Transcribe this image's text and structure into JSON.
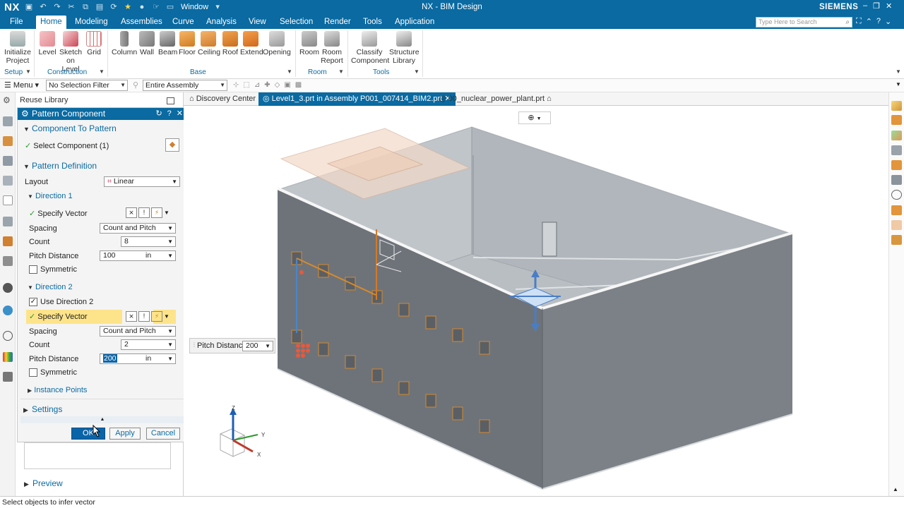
{
  "app": {
    "logo": "NX",
    "title": "NX - BIM Design",
    "brand": "SIEMENS",
    "window_menu": "Window"
  },
  "menubar": {
    "tabs": [
      "File",
      "Home",
      "Modeling",
      "Assemblies",
      "Curve",
      "Analysis",
      "View",
      "Selection",
      "Render",
      "Tools",
      "Application"
    ],
    "active": "Home",
    "search_placeholder": "Type Here to Search"
  },
  "ribbon": {
    "buttons": [
      {
        "label": "Initialize\nProject",
        "icon": "initialize-project-icon"
      },
      {
        "label": "Level",
        "icon": "level-icon"
      },
      {
        "label": "Sketch\non Level",
        "icon": "sketch-on-level-icon"
      },
      {
        "label": "Grid",
        "icon": "grid-icon"
      },
      {
        "label": "Column",
        "icon": "column-icon"
      },
      {
        "label": "Wall",
        "icon": "wall-icon"
      },
      {
        "label": "Beam",
        "icon": "beam-icon"
      },
      {
        "label": "Floor",
        "icon": "floor-icon"
      },
      {
        "label": "Ceiling",
        "icon": "ceiling-icon"
      },
      {
        "label": "Roof",
        "icon": "roof-icon"
      },
      {
        "label": "Extend",
        "icon": "extend-icon"
      },
      {
        "label": "Opening",
        "icon": "opening-icon"
      },
      {
        "label": "Room",
        "icon": "room-icon"
      },
      {
        "label": "Room\nReport",
        "icon": "room-report-icon"
      },
      {
        "label": "Classify\nComponent",
        "icon": "classify-component-icon"
      },
      {
        "label": "Structure\nLibrary",
        "icon": "structure-library-icon"
      }
    ],
    "groups": [
      "Setup",
      "Construction",
      "Base",
      "Room",
      "Tools"
    ]
  },
  "selection_bar": {
    "menu_label": "Menu",
    "filter": "No Selection Filter",
    "scope": "Entire Assembly"
  },
  "left_panel": {
    "reuse_library": "Reuse Library"
  },
  "dialog": {
    "title": "Pattern Component",
    "component_section": "Component To Pattern",
    "select_component": "Select Component (1)",
    "pattern_section": "Pattern Definition",
    "layout_label": "Layout",
    "layout_value": "Linear",
    "direction1": {
      "title": "Direction 1",
      "specify_vector": "Specify Vector",
      "spacing_label": "Spacing",
      "spacing_value": "Count and Pitch",
      "count_label": "Count",
      "count_value": "8",
      "pitch_label": "Pitch Distance",
      "pitch_value": "100",
      "pitch_unit": "in",
      "symmetric_label": "Symmetric",
      "symmetric_checked": false
    },
    "direction2": {
      "title": "Direction 2",
      "use_label": "Use Direction 2",
      "use_checked": true,
      "specify_vector": "Specify Vector",
      "spacing_label": "Spacing",
      "spacing_value": "Count and Pitch",
      "count_label": "Count",
      "count_value": "2",
      "pitch_label": "Pitch Distance",
      "pitch_value": "200",
      "pitch_unit": "in",
      "symmetric_label": "Symmetric",
      "symmetric_checked": false
    },
    "instance_points": "Instance Points",
    "settings": "Settings",
    "ok": "OK",
    "apply": "Apply",
    "cancel": "Cancel",
    "preview": "Preview"
  },
  "doc_tabs": [
    {
      "label": "Discovery Center",
      "active": false
    },
    {
      "label": "Level1_3.prt in Assembly P001_007414_BIM2.prt",
      "active": true
    },
    {
      "label": "00_nuclear_power_plant.prt",
      "active": false
    }
  ],
  "viewport": {
    "pitch_popup_label": "Pitch Distance",
    "pitch_popup_value": "200",
    "triad": {
      "x": "X",
      "y": "Y",
      "z": "Z"
    }
  },
  "status": "Select objects to infer vector",
  "colors": {
    "nx_blue": "#0a6aa1",
    "highlight_yellow": "#fde48a",
    "wall_gray": "#6e737a",
    "window_orange": "#d88a2a"
  }
}
